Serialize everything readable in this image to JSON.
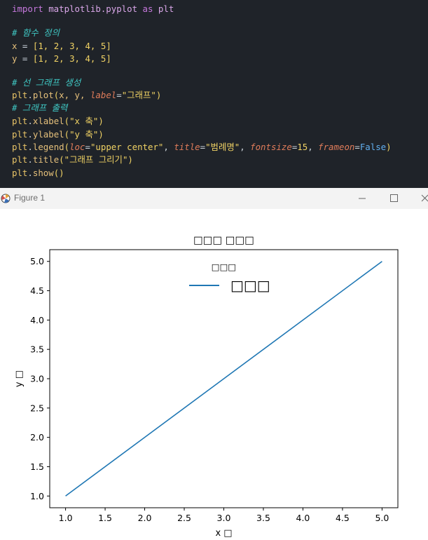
{
  "editor": {
    "lines": [
      [
        {
          "t": "import",
          "c": "kw"
        },
        {
          "t": " matplotlib.pyplot ",
          "c": "plain"
        },
        {
          "t": "as",
          "c": "kw"
        },
        {
          "t": " plt",
          "c": "plain"
        }
      ],
      [],
      [
        {
          "t": "# 함수 정의",
          "c": "cmt"
        }
      ],
      [
        {
          "t": "x",
          "c": "var"
        },
        {
          "t": " = ",
          "c": "op"
        },
        {
          "t": "[",
          "c": "punc"
        },
        {
          "t": "1, 2, 3, 4, 5",
          "c": "num"
        },
        {
          "t": "]",
          "c": "punc"
        }
      ],
      [
        {
          "t": "y",
          "c": "var"
        },
        {
          "t": " = ",
          "c": "op"
        },
        {
          "t": "[",
          "c": "punc"
        },
        {
          "t": "1, 2, 3, 4, 5",
          "c": "num"
        },
        {
          "t": "]",
          "c": "punc"
        }
      ],
      [],
      [
        {
          "t": "# 선 그래프 생성",
          "c": "cmt"
        }
      ],
      [
        {
          "t": "plt",
          "c": "obj"
        },
        {
          "t": ".",
          "c": "op"
        },
        {
          "t": "plot",
          "c": "fn"
        },
        {
          "t": "(",
          "c": "punc"
        },
        {
          "t": "x, y, ",
          "c": "var"
        },
        {
          "t": "label",
          "c": "kwarg"
        },
        {
          "t": "=",
          "c": "op"
        },
        {
          "t": "\"그래프\"",
          "c": "str"
        },
        {
          "t": ")",
          "c": "punc"
        }
      ],
      [
        {
          "t": "# 그래프 출력",
          "c": "cmt"
        }
      ],
      [
        {
          "t": "plt",
          "c": "obj"
        },
        {
          "t": ".",
          "c": "op"
        },
        {
          "t": "xlabel",
          "c": "fn"
        },
        {
          "t": "(",
          "c": "punc"
        },
        {
          "t": "\"x 축\"",
          "c": "str"
        },
        {
          "t": ")",
          "c": "punc"
        }
      ],
      [
        {
          "t": "plt",
          "c": "obj"
        },
        {
          "t": ".",
          "c": "op"
        },
        {
          "t": "ylabel",
          "c": "fn"
        },
        {
          "t": "(",
          "c": "punc"
        },
        {
          "t": "\"y 축\"",
          "c": "str"
        },
        {
          "t": ")",
          "c": "punc"
        }
      ],
      [
        {
          "t": "plt",
          "c": "obj"
        },
        {
          "t": ".",
          "c": "op"
        },
        {
          "t": "legend",
          "c": "fn"
        },
        {
          "t": "(",
          "c": "punc"
        },
        {
          "t": "loc",
          "c": "kwarg"
        },
        {
          "t": "=",
          "c": "op"
        },
        {
          "t": "\"upper center\"",
          "c": "str"
        },
        {
          "t": ", ",
          "c": "op"
        },
        {
          "t": "title",
          "c": "kwarg"
        },
        {
          "t": "=",
          "c": "op"
        },
        {
          "t": "\"범례명\"",
          "c": "str"
        },
        {
          "t": ", ",
          "c": "op"
        },
        {
          "t": "fontsize",
          "c": "kwarg"
        },
        {
          "t": "=",
          "c": "op"
        },
        {
          "t": "15",
          "c": "num"
        },
        {
          "t": ", ",
          "c": "op"
        },
        {
          "t": "frameon",
          "c": "kwarg"
        },
        {
          "t": "=",
          "c": "op"
        },
        {
          "t": "False",
          "c": "const"
        },
        {
          "t": ")",
          "c": "punc"
        }
      ],
      [
        {
          "t": "plt",
          "c": "obj"
        },
        {
          "t": ".",
          "c": "op"
        },
        {
          "t": "title",
          "c": "fn"
        },
        {
          "t": "(",
          "c": "punc"
        },
        {
          "t": "\"그래프 그리기\"",
          "c": "str"
        },
        {
          "t": ")",
          "c": "punc"
        }
      ],
      [
        {
          "t": "plt",
          "c": "obj"
        },
        {
          "t": ".",
          "c": "op"
        },
        {
          "t": "show",
          "c": "fn"
        },
        {
          "t": "()",
          "c": "punc"
        }
      ]
    ]
  },
  "window": {
    "title": "Figure 1",
    "minimize_label": "—",
    "maximize_label": "☐",
    "close_label": "✕",
    "icon": "matplotlib-figure-icon"
  },
  "chart_data": {
    "type": "line",
    "title": "□□□ □□□",
    "xlabel": "x □",
    "ylabel": "y □",
    "x": [
      1.0,
      2.0,
      3.0,
      4.0,
      5.0
    ],
    "series": [
      {
        "name": "□□□",
        "values": [
          1.0,
          2.0,
          3.0,
          4.0,
          5.0
        ],
        "color": "#1f77b4"
      }
    ],
    "legend": {
      "title": "□□□",
      "placement": "upper center",
      "frame": false
    },
    "xlim": [
      0.8,
      5.2
    ],
    "ylim": [
      0.8,
      5.2
    ],
    "xticks": [
      1.0,
      1.5,
      2.0,
      2.5,
      3.0,
      3.5,
      4.0,
      4.5,
      5.0
    ],
    "yticks": [
      1.0,
      1.5,
      2.0,
      2.5,
      3.0,
      3.5,
      4.0,
      4.5,
      5.0
    ],
    "xtick_labels": [
      "1.0",
      "1.5",
      "2.0",
      "2.5",
      "3.0",
      "3.5",
      "4.0",
      "4.5",
      "5.0"
    ],
    "ytick_labels": [
      "1.0",
      "1.5",
      "2.0",
      "2.5",
      "3.0",
      "3.5",
      "4.0",
      "4.5",
      "5.0"
    ],
    "grid": false
  }
}
